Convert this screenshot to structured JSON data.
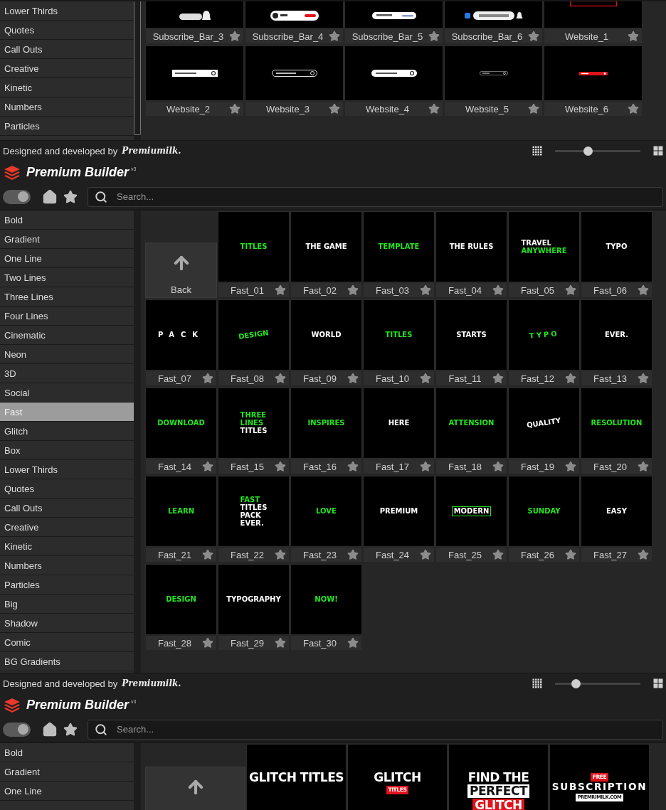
{
  "panels": [
    {
      "sidebar": [
        {
          "label": "Lower Thirds",
          "selected": false
        },
        {
          "label": "Quotes",
          "selected": false
        },
        {
          "label": "Call Outs",
          "selected": false
        },
        {
          "label": "Creative",
          "selected": false
        },
        {
          "label": "Kinetic",
          "selected": false
        },
        {
          "label": "Numbers",
          "selected": false
        },
        {
          "label": "Particles",
          "selected": false
        }
      ],
      "tiles": [
        {
          "label": "Subscribe_Bar_3",
          "kind": "bell-bar"
        },
        {
          "label": "Subscribe_Bar_4",
          "kind": "button-bar"
        },
        {
          "label": "Subscribe_Bar_5",
          "kind": "channel-bar"
        },
        {
          "label": "Subscribe_Bar_6",
          "kind": "like-bar"
        },
        {
          "label": "Website_1",
          "kind": "red-frame"
        },
        {
          "label": "Website_2",
          "kind": "url-box"
        },
        {
          "label": "Website_3",
          "kind": "url-outline"
        },
        {
          "label": "Website_4",
          "kind": "url-pill"
        },
        {
          "label": "Website_5",
          "kind": "url-thin"
        },
        {
          "label": "Website_6",
          "kind": "url-red"
        }
      ],
      "footer": {
        "credit": "Designed and developed by",
        "credit_logo": "Premiumilk.",
        "slider": {
          "level": 0.38
        }
      }
    },
    {
      "header": {
        "title": "Premium Builder",
        "version": "v3"
      },
      "toolbar": {
        "toggle_on": true,
        "search_placeholder": "Search..."
      },
      "sidebar": [
        {
          "label": "Bold",
          "selected": false
        },
        {
          "label": "Gradient",
          "selected": false
        },
        {
          "label": "One Line",
          "selected": false
        },
        {
          "label": "Two Lines",
          "selected": false
        },
        {
          "label": "Three Lines",
          "selected": false
        },
        {
          "label": "Four Lines",
          "selected": false
        },
        {
          "label": "Cinematic",
          "selected": false
        },
        {
          "label": "Neon",
          "selected": false
        },
        {
          "label": "3D",
          "selected": false
        },
        {
          "label": "Social",
          "selected": false
        },
        {
          "label": "Fast",
          "selected": true
        },
        {
          "label": "Glitch",
          "selected": false
        },
        {
          "label": "Box",
          "selected": false
        },
        {
          "label": "Lower Thirds",
          "selected": false
        },
        {
          "label": "Quotes",
          "selected": false
        },
        {
          "label": "Call Outs",
          "selected": false
        },
        {
          "label": "Creative",
          "selected": false
        },
        {
          "label": "Kinetic",
          "selected": false
        },
        {
          "label": "Numbers",
          "selected": false
        },
        {
          "label": "Particles",
          "selected": false
        },
        {
          "label": "Big",
          "selected": false
        },
        {
          "label": "Shadow",
          "selected": false
        },
        {
          "label": "Comic",
          "selected": false
        },
        {
          "label": "BG Gradients",
          "selected": false
        }
      ],
      "tiles": [
        {
          "kind": "back",
          "label": "Back"
        },
        {
          "label": "Fast_01",
          "kind": "center",
          "lines": [
            {
              "text": "TITLES",
              "kind": "green"
            }
          ]
        },
        {
          "label": "Fast_02",
          "kind": "center",
          "lines": [
            {
              "text": "THE GAME",
              "kind": "white"
            }
          ]
        },
        {
          "label": "Fast_03",
          "kind": "center",
          "lines": [
            {
              "text": "TEMPLATE",
              "kind": "green"
            }
          ]
        },
        {
          "label": "Fast_04",
          "kind": "center",
          "lines": [
            {
              "text": "THE RULES",
              "kind": "white"
            }
          ]
        },
        {
          "label": "Fast_05",
          "kind": "stack",
          "lines": [
            {
              "text": "TRAVEL",
              "kind": "white"
            },
            {
              "text": "ANYWHERE",
              "kind": "green"
            }
          ]
        },
        {
          "label": "Fast_06",
          "kind": "center",
          "lines": [
            {
              "text": "TYPO",
              "kind": "white"
            }
          ]
        },
        {
          "label": "Fast_07",
          "kind": "spaced",
          "lines": [
            {
              "text": "PACK",
              "kind": "white"
            }
          ]
        },
        {
          "label": "Fast_08",
          "kind": "tilt",
          "lines": [
            {
              "text": "DESIGN",
              "kind": "green"
            }
          ]
        },
        {
          "label": "Fast_09",
          "kind": "center",
          "lines": [
            {
              "text": "WORLD",
              "kind": "white"
            }
          ]
        },
        {
          "label": "Fast_10",
          "kind": "center",
          "lines": [
            {
              "text": "TITLES",
              "kind": "green"
            }
          ]
        },
        {
          "label": "Fast_11",
          "kind": "center",
          "lines": [
            {
              "text": "STARTS",
              "kind": "white"
            }
          ]
        },
        {
          "label": "Fast_12",
          "kind": "arc",
          "lines": [
            {
              "text": "TYPO",
              "kind": "green"
            }
          ]
        },
        {
          "label": "Fast_13",
          "kind": "center",
          "lines": [
            {
              "text": "EVER.",
              "kind": "white"
            }
          ]
        },
        {
          "label": "Fast_14",
          "kind": "center",
          "lines": [
            {
              "text": "DOWNLOAD",
              "kind": "green"
            }
          ]
        },
        {
          "label": "Fast_15",
          "kind": "stack",
          "lines": [
            {
              "text": "THREE",
              "kind": "green"
            },
            {
              "text": "LINES",
              "kind": "green"
            },
            {
              "text": "TITLES",
              "kind": "white"
            }
          ]
        },
        {
          "label": "Fast_16",
          "kind": "center",
          "lines": [
            {
              "text": "INSPIRES",
              "kind": "green"
            }
          ]
        },
        {
          "label": "Fast_17",
          "kind": "center",
          "lines": [
            {
              "text": "HERE",
              "kind": "white"
            }
          ]
        },
        {
          "label": "Fast_18",
          "kind": "center",
          "lines": [
            {
              "text": "ATTENSION",
              "kind": "green"
            }
          ]
        },
        {
          "label": "Fast_19",
          "kind": "tilt",
          "lines": [
            {
              "text": "QUALITY",
              "kind": "white"
            }
          ]
        },
        {
          "label": "Fast_20",
          "kind": "center",
          "lines": [
            {
              "text": "RESOLUTION",
              "kind": "green"
            }
          ]
        },
        {
          "label": "Fast_21",
          "kind": "center",
          "lines": [
            {
              "text": "LEARN",
              "kind": "green"
            }
          ]
        },
        {
          "label": "Fast_22",
          "kind": "stack",
          "lines": [
            {
              "text": "FAST",
              "kind": "green"
            },
            {
              "text": "TITLES",
              "kind": "white"
            },
            {
              "text": "PACK",
              "kind": "white"
            },
            {
              "text": "EVER.",
              "kind": "white"
            }
          ]
        },
        {
          "label": "Fast_23",
          "kind": "center",
          "lines": [
            {
              "text": "LOVE",
              "kind": "green"
            }
          ]
        },
        {
          "label": "Fast_24",
          "kind": "center",
          "lines": [
            {
              "text": "PREMIUM",
              "kind": "white"
            }
          ]
        },
        {
          "label": "Fast_25",
          "kind": "center",
          "lines": [
            {
              "text": "MODERN",
              "kind": "outlined"
            }
          ]
        },
        {
          "label": "Fast_26",
          "kind": "center",
          "lines": [
            {
              "text": "SUNDAY",
              "kind": "green"
            }
          ]
        },
        {
          "label": "Fast_27",
          "kind": "center",
          "lines": [
            {
              "text": "EASY",
              "kind": "white"
            }
          ]
        },
        {
          "label": "Fast_28",
          "kind": "center",
          "lines": [
            {
              "text": "DESIGN",
              "kind": "green"
            }
          ]
        },
        {
          "label": "Fast_29",
          "kind": "center",
          "lines": [
            {
              "text": "TYPOGRAPHY",
              "kind": "white"
            }
          ]
        },
        {
          "label": "Fast_30",
          "kind": "center",
          "lines": [
            {
              "text": "NOW!",
              "kind": "green"
            }
          ]
        }
      ],
      "footer": {
        "credit": "Designed and developed by",
        "credit_logo": "Premiumilk.",
        "slider": {
          "level": 0.24
        }
      }
    },
    {
      "header": {
        "title": "Premium Builder",
        "version": "v3"
      },
      "toolbar": {
        "toggle_on": true,
        "search_placeholder": "Search..."
      },
      "sidebar": [
        {
          "label": "Bold",
          "selected": false
        },
        {
          "label": "Gradient",
          "selected": false
        },
        {
          "label": "One Line",
          "selected": false
        }
      ],
      "tiles": [
        {
          "kind": "back"
        },
        {
          "kind": "low",
          "lines": [
            {
              "text": "GLITCH TITLES",
              "kind": "white"
            }
          ]
        },
        {
          "kind": "low",
          "lines": [
            {
              "text": "GLITCH",
              "kind": "white"
            },
            {
              "text": "TITLES",
              "kind": "red-tag"
            }
          ]
        },
        {
          "kind": "low",
          "lines": [
            {
              "text": "FIND THE",
              "kind": "white"
            },
            {
              "text": "PERFECT",
              "kind": "white-box"
            },
            {
              "text": "GLITCH",
              "kind": "red-box"
            }
          ]
        },
        {
          "kind": "low",
          "lines": [
            {
              "text": "FREE",
              "kind": "red-tag"
            },
            {
              "text": "SUBSCRIPTION",
              "kind": "spaced-white"
            },
            {
              "text": "PREMIUMILK.COM",
              "kind": "white-tag"
            }
          ]
        }
      ]
    }
  ]
}
